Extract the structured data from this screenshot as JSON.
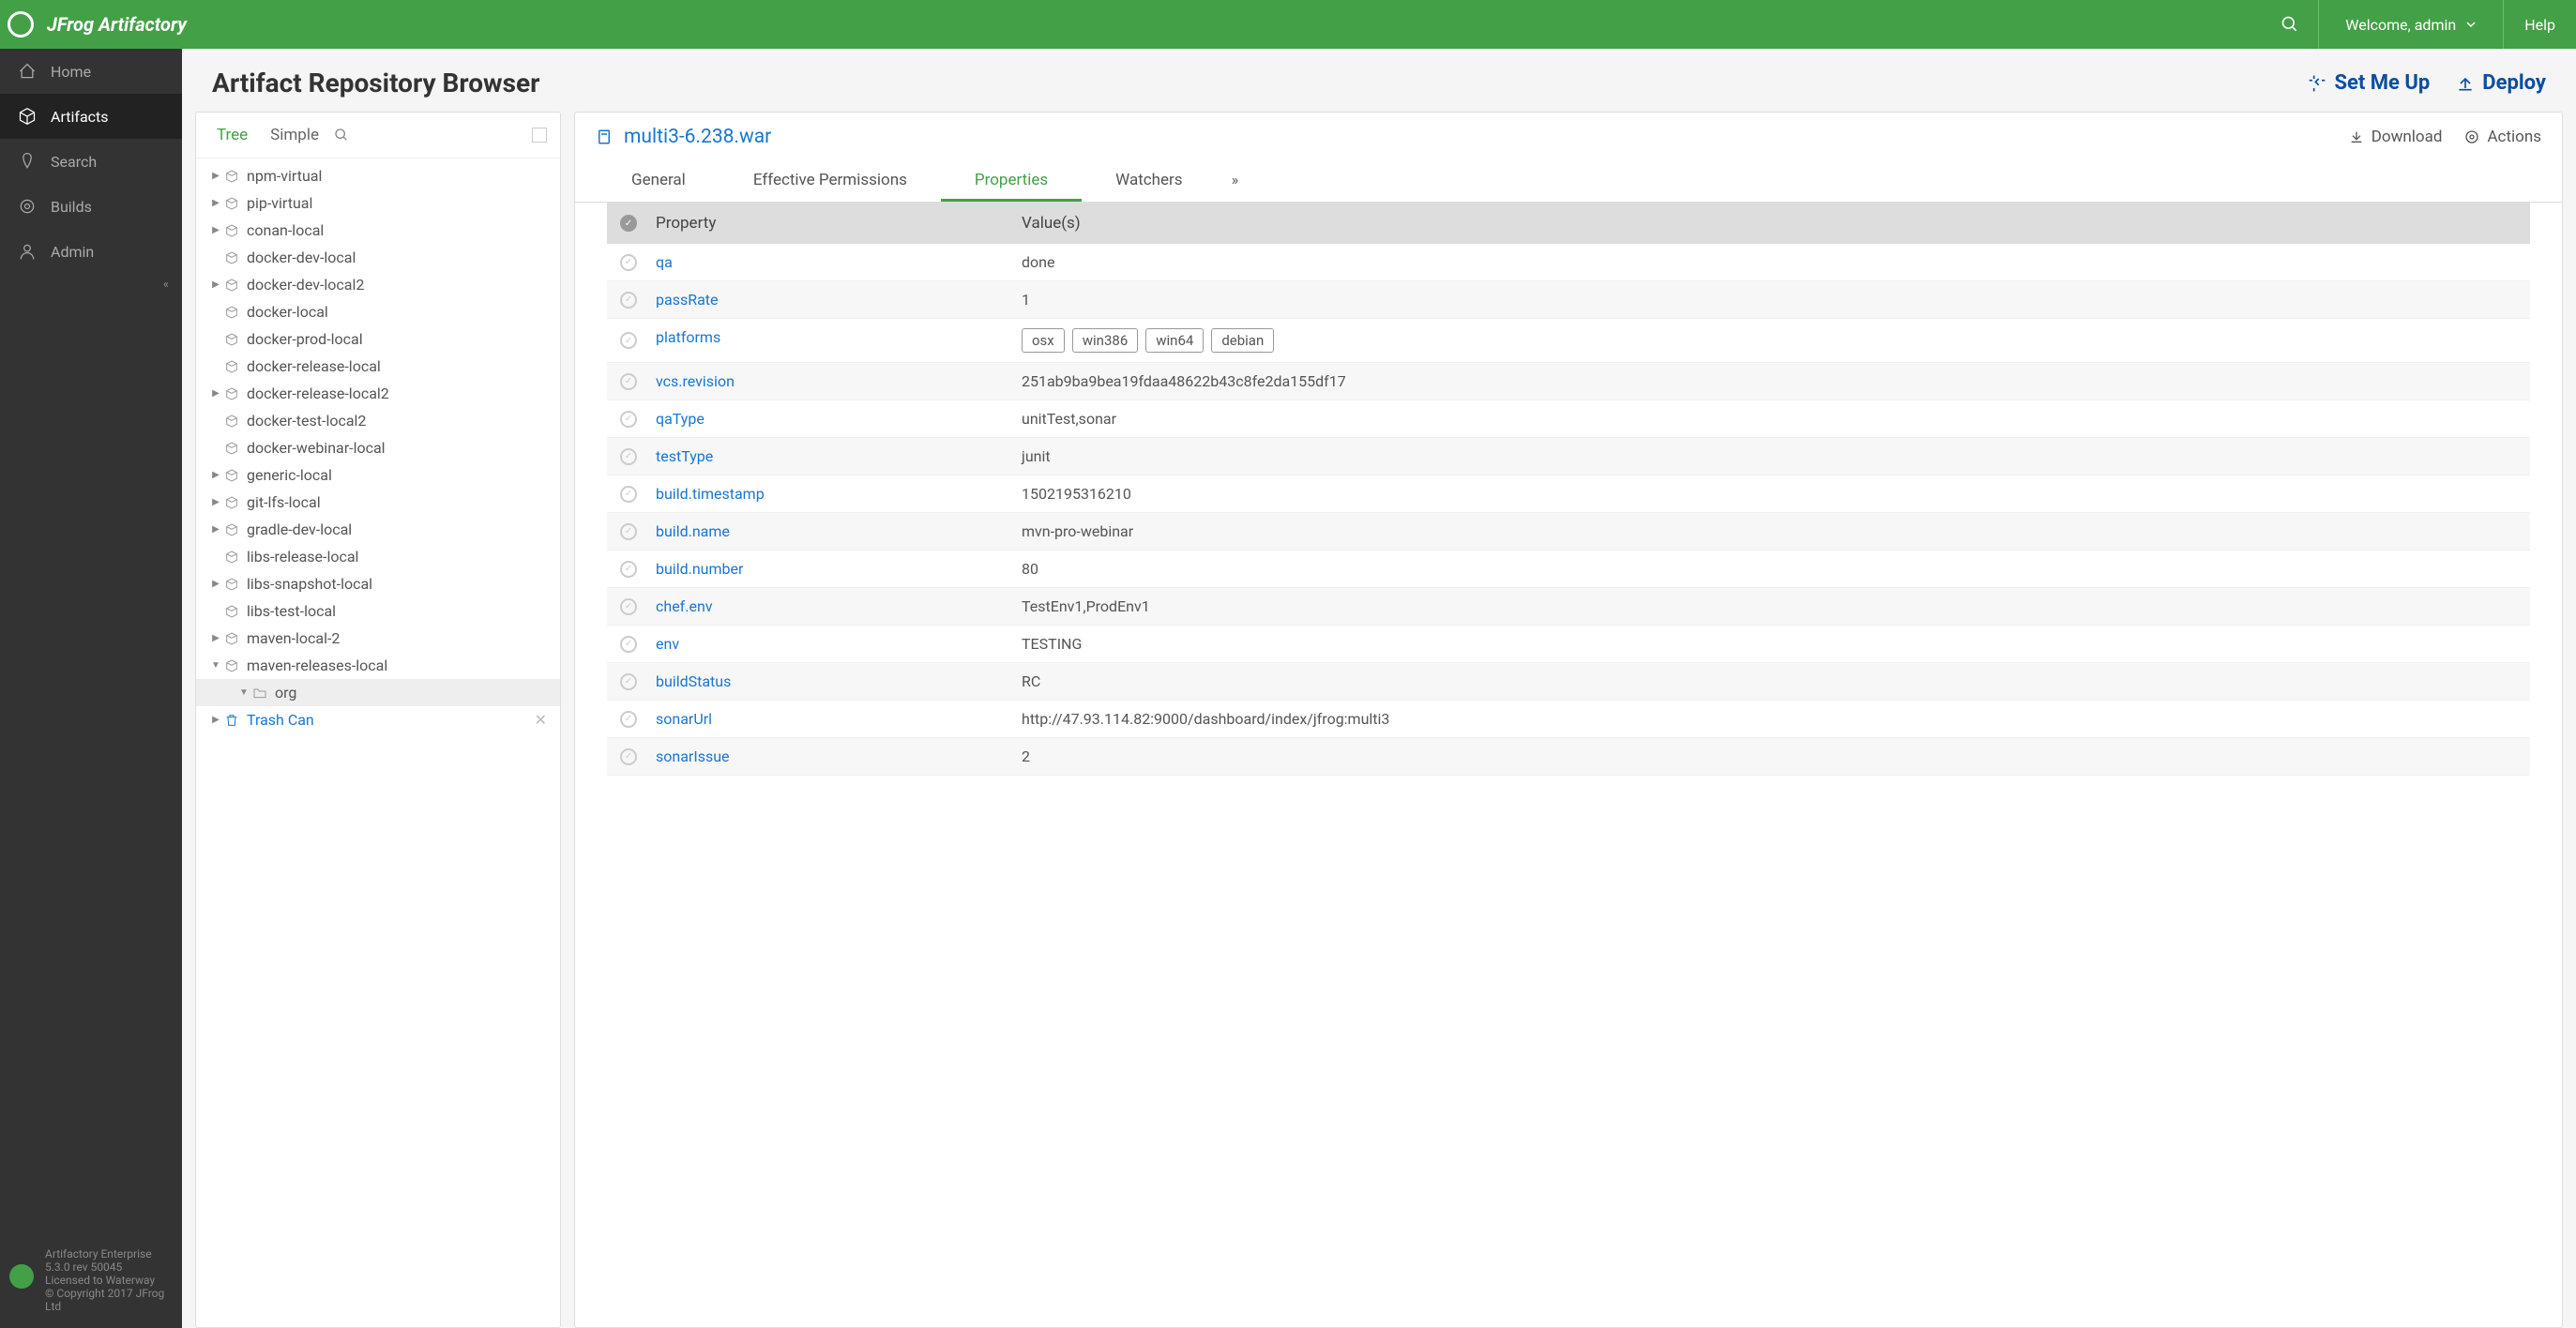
{
  "header": {
    "logo": "JFrog Artifactory",
    "welcome": "Welcome, admin",
    "help": "Help"
  },
  "sidebar": {
    "items": [
      {
        "label": "Home",
        "icon": "home"
      },
      {
        "label": "Artifacts",
        "icon": "package",
        "active": true
      },
      {
        "label": "Search",
        "icon": "search"
      },
      {
        "label": "Builds",
        "icon": "builds"
      },
      {
        "label": "Admin",
        "icon": "admin"
      }
    ],
    "footer": {
      "product": "Artifactory Enterprise",
      "version": "5.3.0 rev 50045",
      "license": "Licensed to Waterway",
      "copyright": "© Copyright 2017 JFrog Ltd"
    }
  },
  "page": {
    "title": "Artifact Repository Browser",
    "setMeUp": "Set Me Up",
    "deploy": "Deploy"
  },
  "treeTabs": {
    "tree": "Tree",
    "simple": "Simple"
  },
  "tree": [
    {
      "label": "npm-virtual",
      "expandable": true
    },
    {
      "label": "pip-virtual",
      "expandable": true
    },
    {
      "label": "conan-local",
      "expandable": true
    },
    {
      "label": "docker-dev-local",
      "expandable": false
    },
    {
      "label": "docker-dev-local2",
      "expandable": true
    },
    {
      "label": "docker-local",
      "expandable": false
    },
    {
      "label": "docker-prod-local",
      "expandable": false
    },
    {
      "label": "docker-release-local",
      "expandable": false
    },
    {
      "label": "docker-release-local2",
      "expandable": true
    },
    {
      "label": "docker-test-local2",
      "expandable": false
    },
    {
      "label": "docker-webinar-local",
      "expandable": false
    },
    {
      "label": "generic-local",
      "expandable": true
    },
    {
      "label": "git-lfs-local",
      "expandable": true
    },
    {
      "label": "gradle-dev-local",
      "expandable": true
    },
    {
      "label": "libs-release-local",
      "expandable": false
    },
    {
      "label": "libs-snapshot-local",
      "expandable": true
    },
    {
      "label": "libs-test-local",
      "expandable": false
    },
    {
      "label": "maven-local-2",
      "expandable": true
    },
    {
      "label": "maven-releases-local",
      "expandable": true,
      "expanded": true
    }
  ],
  "treeChild": "org",
  "trash": "Trash Can",
  "detail": {
    "artifact": "multi3-6.238.war",
    "download": "Download",
    "actions": "Actions",
    "tabs": [
      "General",
      "Effective Permissions",
      "Properties",
      "Watchers"
    ],
    "activeTab": 2,
    "columns": {
      "prop": "Property",
      "val": "Value(s)"
    },
    "properties": [
      {
        "key": "qa",
        "value": "done"
      },
      {
        "key": "passRate",
        "value": "1"
      },
      {
        "key": "platforms",
        "chips": [
          "osx",
          "win386",
          "win64",
          "debian"
        ]
      },
      {
        "key": "vcs.revision",
        "value": "251ab9ba9bea19fdaa48622b43c8fe2da155df17"
      },
      {
        "key": "qaType",
        "value": "unitTest,sonar"
      },
      {
        "key": "testType",
        "value": "junit"
      },
      {
        "key": "build.timestamp",
        "value": "1502195316210"
      },
      {
        "key": "build.name",
        "value": "mvn-pro-webinar"
      },
      {
        "key": "build.number",
        "value": "80"
      },
      {
        "key": "chef.env",
        "value": "TestEnv1,ProdEnv1"
      },
      {
        "key": "env",
        "value": "TESTING"
      },
      {
        "key": "buildStatus",
        "value": "RC"
      },
      {
        "key": "sonarUrl",
        "value": "http://47.93.114.82:9000/dashboard/index/jfrog:multi3"
      },
      {
        "key": "sonarIssue",
        "value": "2"
      }
    ]
  }
}
